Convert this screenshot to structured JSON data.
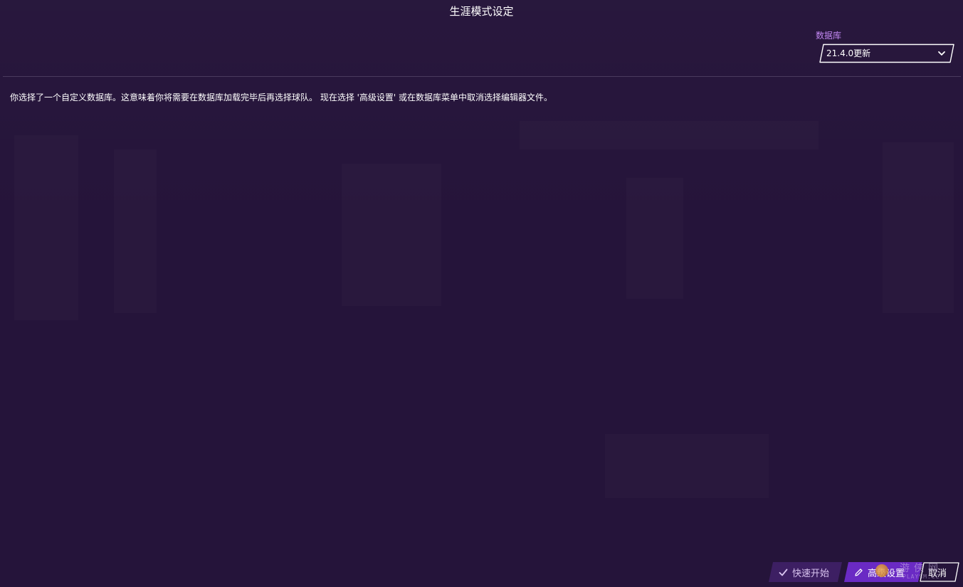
{
  "header": {
    "title": "生涯模式设定"
  },
  "database": {
    "label": "数据库",
    "selected": "21.4.0更新",
    "icon": "chevron-down-icon"
  },
  "main": {
    "notice": "你选择了一个自定义数据库。这意味着你将需要在数据库加载完毕后再选择球队。 现在选择 '高级设置' 或在数据库菜单中取消选择编辑器文件。"
  },
  "footer": {
    "quick_start_label": "快速开始",
    "quick_start_icon": "check-icon",
    "advanced_label": "高级设置",
    "advanced_icon": "pencil-icon",
    "cancel_label": "取消"
  },
  "watermark": {
    "text": "游侠网",
    "sub": "PLAYSM.CC"
  },
  "colors": {
    "background": "#25143a",
    "accent": "#c287f2",
    "primary_button": "#6a2ac4",
    "secondary_button": "#3d1f63"
  }
}
